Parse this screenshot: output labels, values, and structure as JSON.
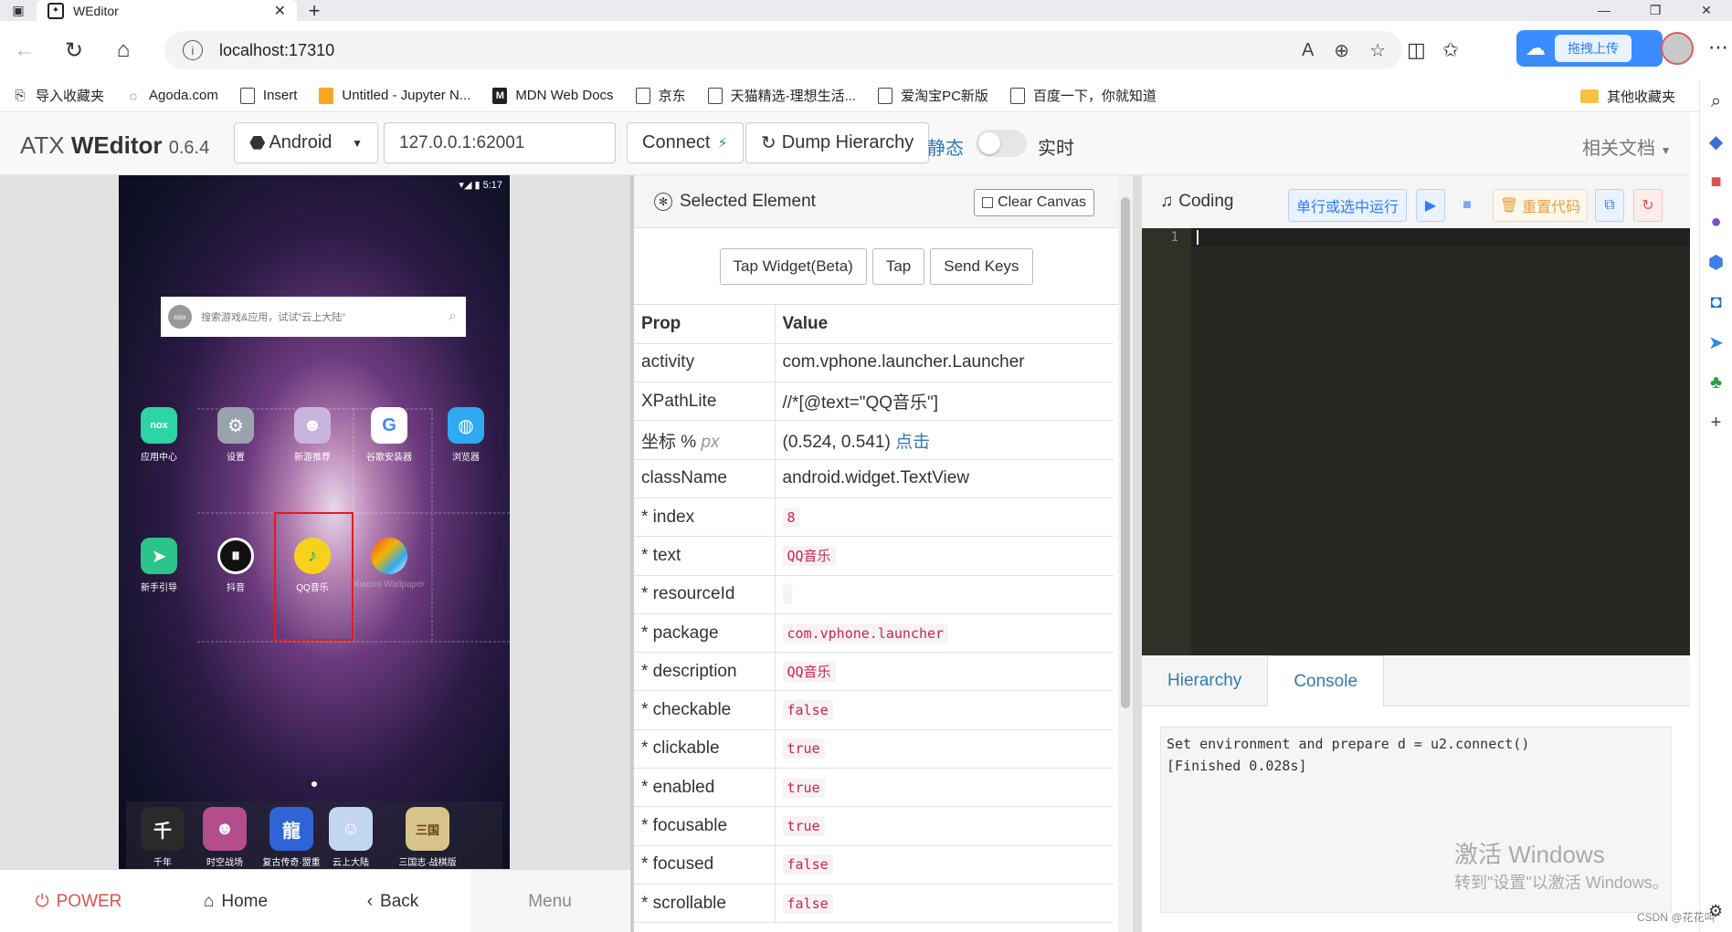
{
  "browser": {
    "tab_title": "WEditor",
    "url": "localhost:17310",
    "baidu_label": "拖拽上传",
    "bookmarks": [
      "导入收藏夹",
      "Agoda.com",
      "Insert",
      "Untitled - Jupyter N...",
      "MDN Web Docs",
      "京东",
      "天猫精选-理想生活...",
      "爱淘宝PC新版",
      "百度一下，你就知道"
    ],
    "other_bookmarks": "其他收藏夹"
  },
  "header": {
    "brand_prefix": "ATX ",
    "brand_name": "WEditor",
    "version": "0.6.4",
    "platform": "Android",
    "device_address": "127.0.0.1:62001",
    "connect_label": "Connect",
    "dump_label": "Dump Hierarchy",
    "mode_static": "静态",
    "mode_live": "实时",
    "docs_label": "相关文档"
  },
  "phone": {
    "status_time": "5:17",
    "search_placeholder": "搜索游戏&应用，试试\"云上大陆\"",
    "nox_label": "nox",
    "apps_row1": [
      "应用中心",
      "设置",
      "新游推荐",
      "谷歌安装器",
      "浏览器"
    ],
    "apps_row2": [
      "新手引导",
      "抖音",
      "QQ音乐",
      "Xiaomi Wallpaper"
    ],
    "dock_apps": [
      "千年",
      "时空战场",
      "复古传奇·盟重",
      "云上大陆",
      "三国志·战棋版"
    ],
    "buttons": {
      "power": "POWER",
      "home": "Home",
      "back": "Back",
      "menu": "Menu"
    }
  },
  "selected": {
    "title": "Selected Element",
    "clear_canvas": "Clear Canvas",
    "actions": [
      "Tap Widget(Beta)",
      "Tap",
      "Send Keys"
    ],
    "prop_header": "Prop",
    "value_header": "Value",
    "coord_label": "坐标 %",
    "coord_px": "px",
    "coord_value": "(0.524, 0.541)",
    "coord_link": "点击",
    "rows": {
      "activity": {
        "k": "activity",
        "v": "com.vphone.launcher.Launcher"
      },
      "xpath": {
        "k": "XPathLite",
        "v": "//*[@text=\"QQ音乐\"]"
      },
      "classname": {
        "k": "className",
        "v": "android.widget.TextView"
      },
      "index": {
        "k": "* index",
        "v": "8"
      },
      "text": {
        "k": "* text",
        "v": "QQ音乐"
      },
      "resourceid": {
        "k": "* resourceId",
        "v": ""
      },
      "package": {
        "k": "* package",
        "v": "com.vphone.launcher"
      },
      "description": {
        "k": "* description",
        "v": "QQ音乐"
      },
      "checkable": {
        "k": "* checkable",
        "v": "false"
      },
      "clickable": {
        "k": "* clickable",
        "v": "true"
      },
      "enabled": {
        "k": "* enabled",
        "v": "true"
      },
      "focusable": {
        "k": "* focusable",
        "v": "true"
      },
      "focused": {
        "k": "* focused",
        "v": "false"
      },
      "scrollable": {
        "k": "* scrollable",
        "v": "false"
      }
    }
  },
  "coding": {
    "title": "Coding",
    "run_label": "单行或选中运行",
    "reset_label": "重置代码",
    "line_number": "1",
    "tabs": [
      "Hierarchy",
      "Console"
    ],
    "console_lines": [
      "Set environment and prepare d = u2.connect()",
      "[Finished 0.028s]"
    ]
  },
  "watermark": {
    "line1": "激活 Windows",
    "line2": "转到\"设置\"以激活 Windows。",
    "csdn": "CSDN @花花叫"
  },
  "colors": {
    "link": "#337ab7",
    "editor_bg": "#272822",
    "code_red": "#c7254e",
    "selection_rect": "#e21b1b",
    "power_red": "#d9534f"
  },
  "icons": [
    "window-icon",
    "weditor-favicon",
    "back-icon",
    "reload-icon",
    "home-icon",
    "info-icon",
    "read-aloud-icon",
    "zoom-icon",
    "favorite-icon",
    "split-icon",
    "favorites-icon",
    "cloud-icon",
    "gear-icon",
    "android-icon",
    "refresh-icon",
    "music-icon",
    "play-icon",
    "stop-icon",
    "trash-icon",
    "copy-icon",
    "reload-code-icon",
    "power-icon"
  ]
}
